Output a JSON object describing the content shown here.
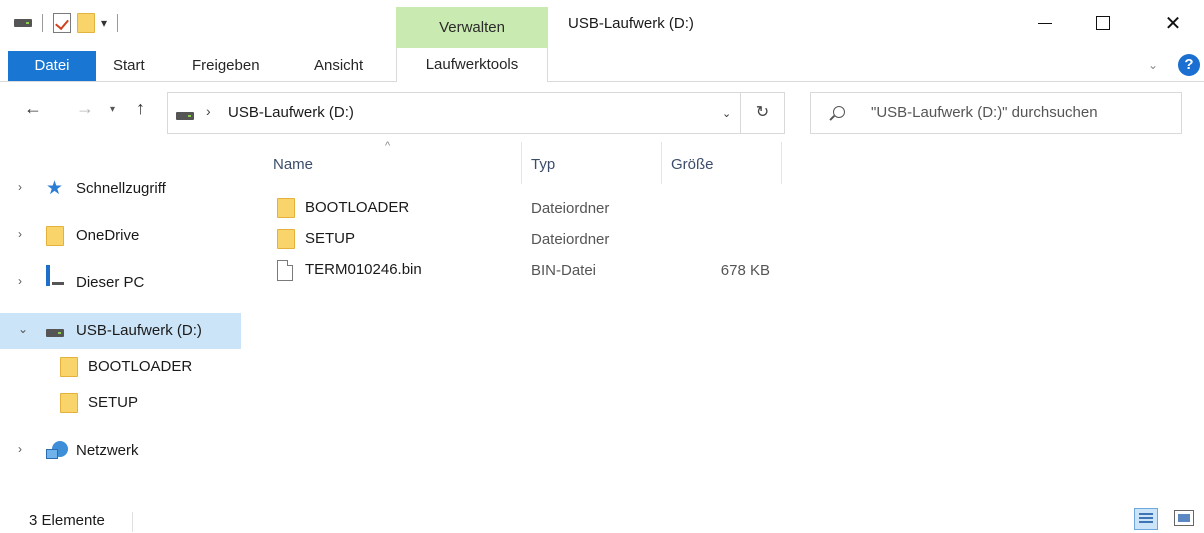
{
  "window": {
    "title": "USB-Laufwerk (D:)",
    "context_group": "Verwalten"
  },
  "ribbon": {
    "tabs": [
      "Datei",
      "Start",
      "Freigeben",
      "Ansicht",
      "Laufwerktools"
    ],
    "active_color": "#1976d2",
    "context_color": "#c9eab0"
  },
  "address": {
    "path": "USB-Laufwerk (D:)",
    "search_placeholder": "\"USB-Laufwerk (D:)\" durchsuchen"
  },
  "sidebar": {
    "items": [
      {
        "label": "Schnellzugriff",
        "icon": "star-icon"
      },
      {
        "label": "OneDrive",
        "icon": "folder-icon"
      },
      {
        "label": "Dieser PC",
        "icon": "pc-icon"
      },
      {
        "label": "USB-Laufwerk (D:)",
        "icon": "drive-icon",
        "selected": true
      },
      {
        "label": "BOOTLOADER",
        "icon": "folder-icon"
      },
      {
        "label": "SETUP",
        "icon": "folder-icon"
      },
      {
        "label": "Netzwerk",
        "icon": "network-icon"
      }
    ],
    "selected_color": "#cce4f7"
  },
  "columns": {
    "name": "Name",
    "type": "Typ",
    "size": "Größe"
  },
  "files": [
    {
      "name": "BOOTLOADER",
      "type": "Dateiordner",
      "size": "",
      "icon": "folder-icon"
    },
    {
      "name": "SETUP",
      "type": "Dateiordner",
      "size": "",
      "icon": "folder-icon"
    },
    {
      "name": "TERM010246.bin",
      "type": "BIN-Datei",
      "size": "678 KB",
      "icon": "file-icon"
    }
  ],
  "status": {
    "count": "3 Elemente"
  }
}
